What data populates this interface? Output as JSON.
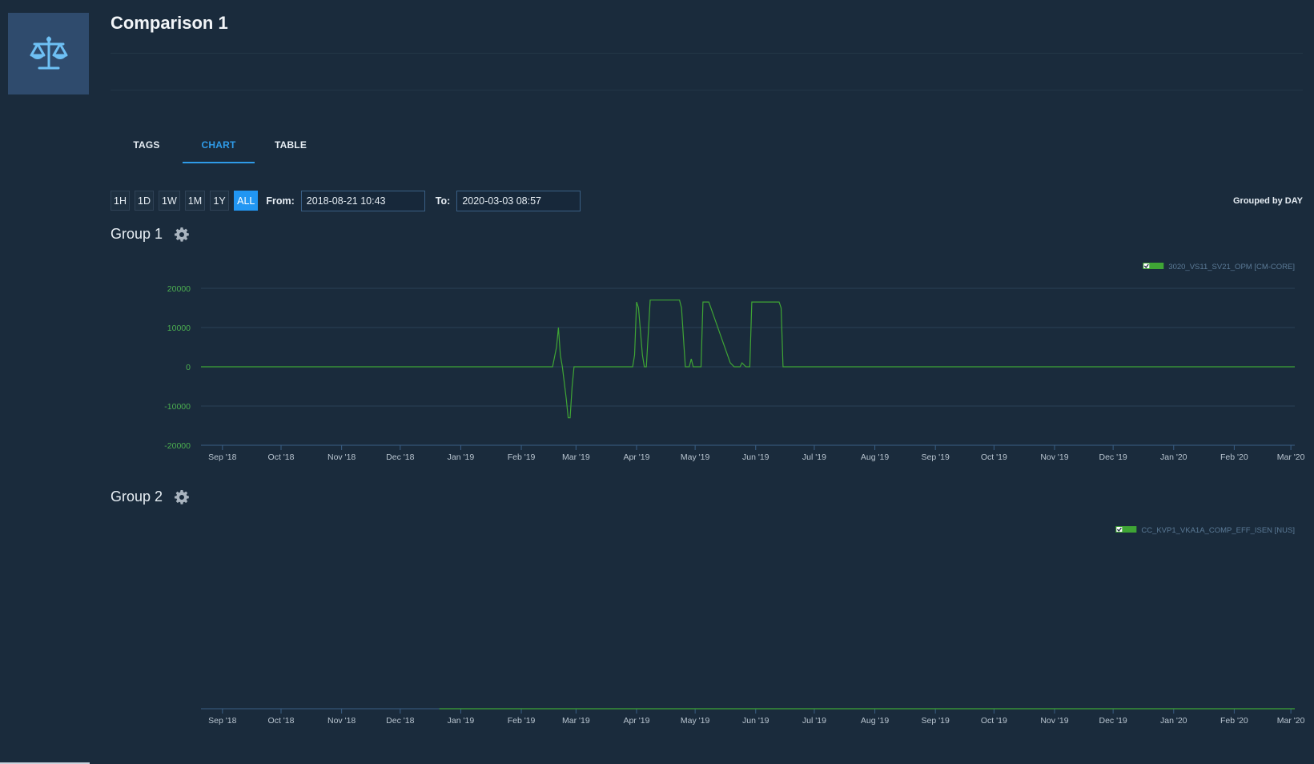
{
  "page": {
    "title": "Comparison 1",
    "icon": "scales-icon"
  },
  "tabs": [
    {
      "label": "TAGS",
      "active": false
    },
    {
      "label": "CHART",
      "active": true
    },
    {
      "label": "TABLE",
      "active": false
    }
  ],
  "toolbar": {
    "ranges": [
      "1H",
      "1D",
      "1W",
      "1M",
      "1Y",
      "ALL"
    ],
    "active_range": "ALL",
    "from_label": "From:",
    "from_value": "2018-08-21 10:43",
    "to_label": "To:",
    "to_value": "2020-03-03 08:57",
    "grouped_by": "Grouped by DAY"
  },
  "colors": {
    "accent": "#2196f3",
    "series": "#3fa535",
    "background": "#1a2b3c",
    "axis_tick": "#4caf50"
  },
  "groups": [
    {
      "title": "Group 1",
      "icon": "gear-icon"
    },
    {
      "title": "Group 2",
      "icon": "gear-icon"
    }
  ],
  "chart_data": [
    {
      "type": "line",
      "title": "",
      "xlabel": "",
      "ylabel": "",
      "x_ticks": [
        "Sep '18",
        "Oct '18",
        "Nov '18",
        "Dec '18",
        "Jan '19",
        "Feb '19",
        "Mar '19",
        "Apr '19",
        "May '19",
        "Jun '19",
        "Jul '19",
        "Aug '19",
        "Sep '19",
        "Oct '19",
        "Nov '19",
        "Dec '19",
        "Jan '20",
        "Feb '20",
        "Mar '20"
      ],
      "y_ticks": [
        20000,
        10000,
        0,
        -10000,
        -20000
      ],
      "ylim": [
        -20000,
        20000
      ],
      "xlim": [
        "2018-08-21",
        "2020-03-03"
      ],
      "grid": true,
      "legend": "top-right",
      "series": [
        {
          "name": "3020_VS11_SV21_OPM [CM-CORE]",
          "color": "#3fa535",
          "points": [
            [
              "2018-08-21",
              0
            ],
            [
              "2019-02-17",
              0
            ],
            [
              "2019-02-19",
              5000
            ],
            [
              "2019-02-20",
              10000
            ],
            [
              "2019-02-21",
              3000
            ],
            [
              "2019-02-22",
              0
            ],
            [
              "2019-02-24",
              -8000
            ],
            [
              "2019-02-25",
              -13000
            ],
            [
              "2019-02-26",
              -13000
            ],
            [
              "2019-02-27",
              -5000
            ],
            [
              "2019-02-28",
              0
            ],
            [
              "2019-03-30",
              0
            ],
            [
              "2019-03-31",
              3000
            ],
            [
              "2019-04-01",
              16500
            ],
            [
              "2019-04-02",
              15000
            ],
            [
              "2019-04-04",
              3000
            ],
            [
              "2019-04-05",
              0
            ],
            [
              "2019-04-06",
              0
            ],
            [
              "2019-04-08",
              17000
            ],
            [
              "2019-04-23",
              17000
            ],
            [
              "2019-04-24",
              15000
            ],
            [
              "2019-04-26",
              0
            ],
            [
              "2019-04-28",
              0
            ],
            [
              "2019-04-29",
              2000
            ],
            [
              "2019-04-30",
              0
            ],
            [
              "2019-05-04",
              0
            ],
            [
              "2019-05-05",
              16500
            ],
            [
              "2019-05-08",
              16500
            ],
            [
              "2019-05-19",
              1000
            ],
            [
              "2019-05-21",
              0
            ],
            [
              "2019-05-24",
              0
            ],
            [
              "2019-05-25",
              1000
            ],
            [
              "2019-05-27",
              0
            ],
            [
              "2019-05-29",
              0
            ],
            [
              "2019-05-30",
              16500
            ],
            [
              "2019-06-13",
              16500
            ],
            [
              "2019-06-14",
              15000
            ],
            [
              "2019-06-15",
              0
            ],
            [
              "2020-03-03",
              0
            ]
          ]
        }
      ]
    },
    {
      "type": "line",
      "title": "",
      "xlabel": "",
      "ylabel": "",
      "x_ticks": [
        "Sep '18",
        "Oct '18",
        "Nov '18",
        "Dec '18",
        "Jan '19",
        "Feb '19",
        "Mar '19",
        "Apr '19",
        "May '19",
        "Jun '19",
        "Jul '19",
        "Aug '19",
        "Sep '19",
        "Oct '19",
        "Nov '19",
        "Dec '19",
        "Jan '20",
        "Feb '20",
        "Mar '20"
      ],
      "y_ticks": [],
      "xlim": [
        "2018-08-21",
        "2020-03-03"
      ],
      "grid": false,
      "legend": "top-right",
      "series": [
        {
          "name": "CC_KVP1_VKA1A_COMP_EFF_ISEN [NUS]",
          "color": "#3fa535",
          "points": [
            [
              "2018-12-21",
              0
            ],
            [
              "2020-03-03",
              0
            ]
          ]
        }
      ]
    }
  ]
}
